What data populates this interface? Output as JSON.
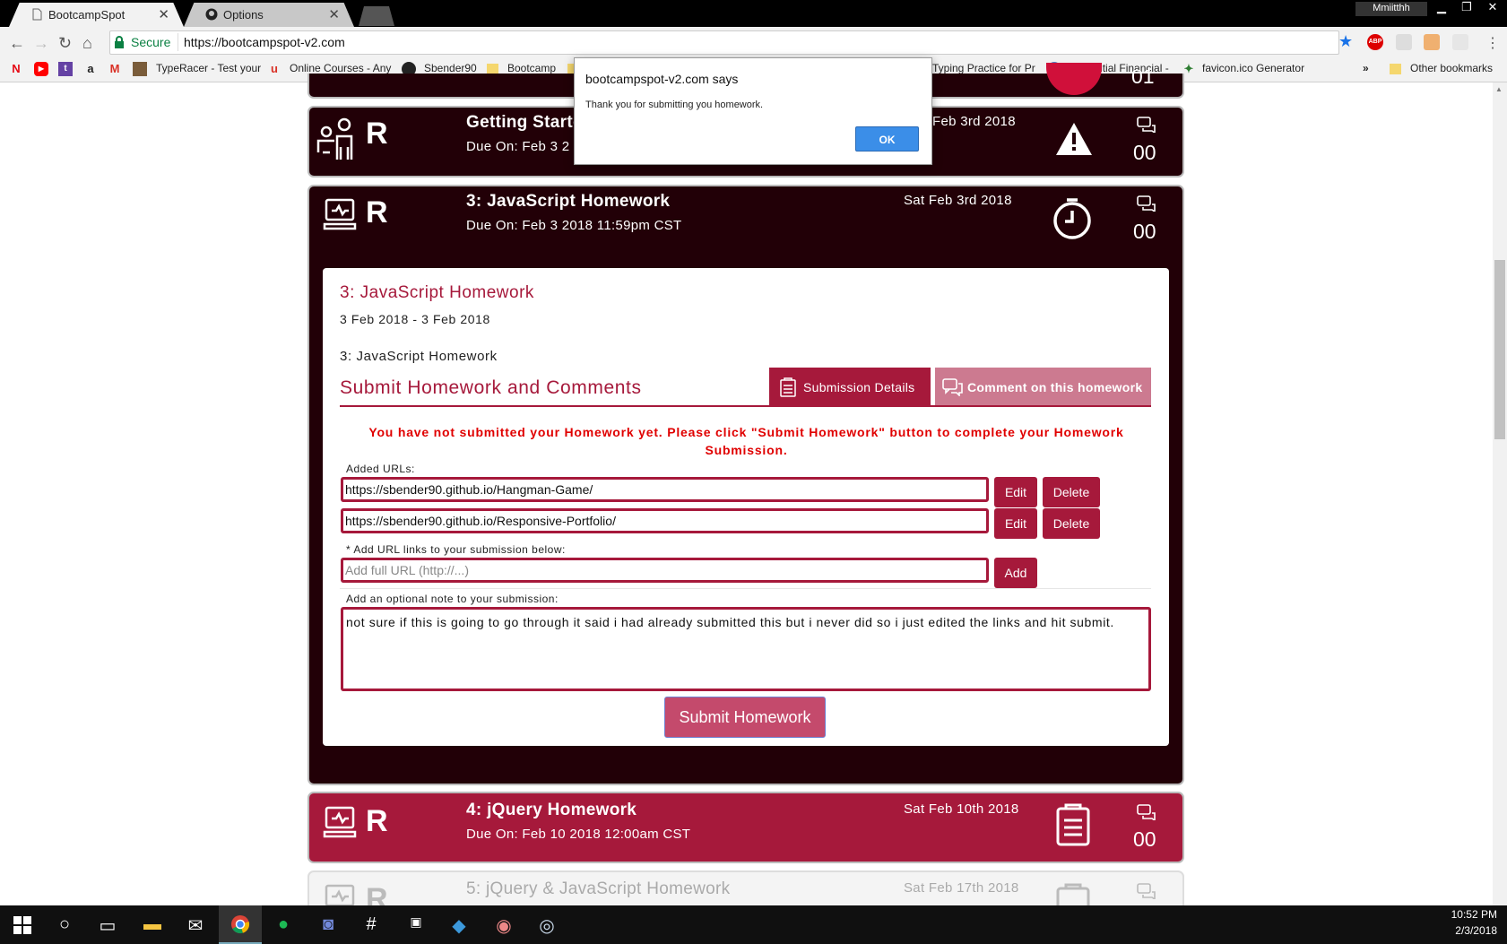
{
  "browser": {
    "tabs": [
      {
        "title": "BootcampSpot"
      },
      {
        "title": "Options"
      }
    ],
    "user": "Mmiitthh",
    "secure_label": "Secure",
    "url": "https://bootcampspot-v2.com"
  },
  "bookmarks": [
    {
      "label": "TypeRacer - Test your"
    },
    {
      "label": "Online Courses - Any"
    },
    {
      "label": "Sbender90"
    },
    {
      "label": "Bootcamp"
    },
    {
      "label": "Typing Practice for Pr"
    },
    {
      "label": "Prudential Financial -"
    },
    {
      "label": "favicon.ico Generator"
    },
    {
      "label": "»"
    },
    {
      "label": "Other bookmarks"
    }
  ],
  "dialog": {
    "title": "bootcampspot-v2.com says",
    "message": "Thank you for submitting you homework.",
    "ok": "OK"
  },
  "cards": [
    {
      "count": "01"
    },
    {
      "letter": "R",
      "title": "Getting Starte",
      "due": "Due On: Feb 3 2",
      "date": "Feb 3rd 2018",
      "count": "00"
    },
    {
      "letter": "R",
      "title": "3: JavaScript Homework",
      "due": "Due On: Feb 3 2018 11:59pm CST",
      "date": "Sat Feb 3rd 2018",
      "count": "00"
    },
    {
      "letter": "R",
      "title": "4: jQuery Homework",
      "due": "Due On: Feb 10 2018 12:00am CST",
      "date": "Sat Feb 10th 2018",
      "count": "00"
    },
    {
      "letter": "R",
      "title": "5: jQuery & JavaScript Homework",
      "date": "Sat Feb 17th 2018"
    }
  ],
  "panel": {
    "title": "3: JavaScript Homework",
    "range": "3 Feb 2018 - 3 Feb 2018",
    "description": "3: JavaScript Homework",
    "section_title": "Submit Homework and Comments",
    "tab_details": "Submission Details",
    "tab_comment": "Comment on this homework",
    "warning": "You have not submitted your Homework yet. Please click \"Submit Homework\" button to complete your Homework Submission.",
    "added_urls_label": "Added URLs:",
    "urls": [
      "https://sbender90.github.io/Hangman-Game/",
      "https://sbender90.github.io/Responsive-Portfolio/"
    ],
    "edit": "Edit",
    "delete": "Delete",
    "add_label": "* Add URL links to your submission below:",
    "add_placeholder": "Add full URL (http://...)",
    "add": "Add",
    "note_label": "Add an optional note to your submission:",
    "note": "not sure if this is going to go through it said i had already submitted this but i never did so i just edited the links and hit submit.",
    "submit": "Submit Homework"
  },
  "taskbar": {
    "time": "10:52 PM",
    "date": "2/3/2018"
  },
  "colors": {
    "crimson": "#a6193b",
    "dark": "#220007",
    "warning": "#e00000"
  }
}
